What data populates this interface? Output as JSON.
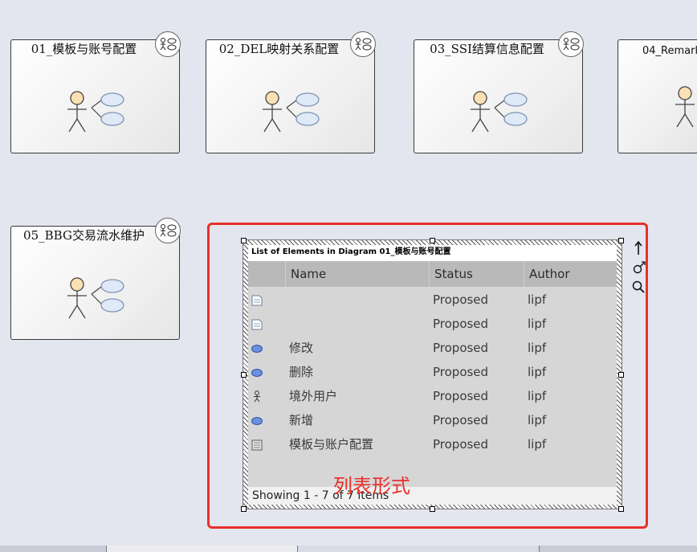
{
  "diagrams": [
    {
      "title": "01_模板与账号配置"
    },
    {
      "title": "02_DEL映射关系配置"
    },
    {
      "title": "03_SSI结算信息配置"
    },
    {
      "title": "04_Remark"
    },
    {
      "title": "05_BBG交易流水维护"
    }
  ],
  "element_list": {
    "header": "List of Elements in Diagram 01_模板与账号配置",
    "columns": [
      "Name",
      "Status",
      "Author"
    ],
    "rows": [
      {
        "icon": "note-icon",
        "name": "",
        "status": "Proposed",
        "author": "lipf"
      },
      {
        "icon": "note-icon",
        "name": "",
        "status": "Proposed",
        "author": "lipf"
      },
      {
        "icon": "use-case-icon",
        "name": "修改",
        "status": "Proposed",
        "author": "lipf"
      },
      {
        "icon": "use-case-icon",
        "name": "删除",
        "status": "Proposed",
        "author": "lipf"
      },
      {
        "icon": "actor-icon",
        "name": "境外用户",
        "status": "Proposed",
        "author": "lipf"
      },
      {
        "icon": "use-case-icon",
        "name": "新增",
        "status": "Proposed",
        "author": "lipf"
      },
      {
        "icon": "diagram-icon",
        "name": "模板与账户配置",
        "status": "Proposed",
        "author": "lipf"
      }
    ],
    "footer": "Showing 1 - 7 of 7 items"
  },
  "annotation": "列表形式",
  "colors": {
    "highlight": "#e8302a",
    "header_bg": "#b9b9b9",
    "panel_bg": "#d6d6d6",
    "use_case_fill": "#dfe9f7"
  }
}
